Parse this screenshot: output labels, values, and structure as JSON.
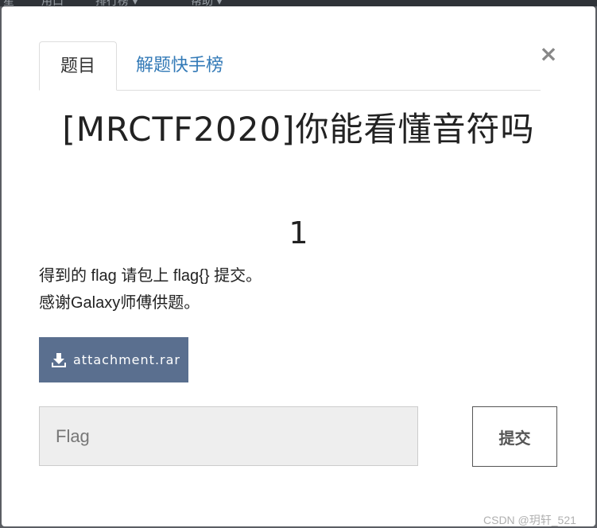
{
  "background": {
    "nav_fragments": [
      "星",
      "用口",
      "排行榜 ▾",
      "帮助 ▾"
    ]
  },
  "modal": {
    "tabs": [
      {
        "label": "题目",
        "active": true
      },
      {
        "label": "解题快手榜",
        "active": false
      }
    ],
    "close_label": "×",
    "challenge": {
      "title": "[MRCTF2020]你能看懂音符吗",
      "points": "1",
      "description_lines": [
        "得到的 flag 请包上 flag{} 提交。",
        "感谢Galaxy师傅供题。"
      ],
      "attachment": {
        "label": "attachment.rar",
        "icon": "download-icon"
      }
    },
    "flag_form": {
      "placeholder": "Flag",
      "value": "",
      "submit_label": "提交"
    }
  },
  "watermark": "CSDN @玥轩_521",
  "colors": {
    "tab_link": "#337ab7",
    "attachment_button": "#5a6f8f",
    "input_background": "#eeeeee"
  }
}
